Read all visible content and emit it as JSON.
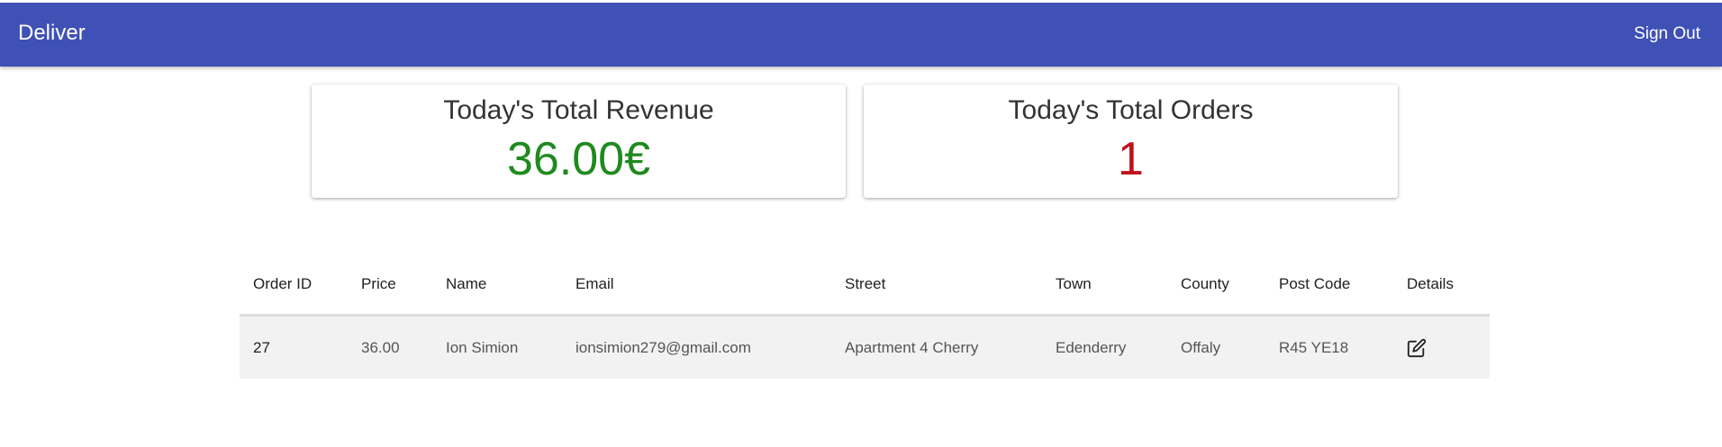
{
  "header": {
    "brand": "Deliver",
    "sign_out_label": "Sign Out",
    "bg_color": "#3f51b5"
  },
  "stats": [
    {
      "title": "Today's Total Revenue",
      "value": "36.00€",
      "color": "#1e8a1e"
    },
    {
      "title": "Today's Total Orders",
      "value": "1",
      "color": "#c0111a"
    }
  ],
  "orders_table": {
    "columns": [
      "Order ID",
      "Price",
      "Name",
      "Email",
      "Street",
      "Town",
      "County",
      "Post Code",
      "Details"
    ],
    "rows": [
      {
        "order_id": "27",
        "price": "36.00",
        "name": "Ion Simion",
        "email": "ionsimion279@gmail.com",
        "street": "Apartment 4 Cherry",
        "town": "Edenderry",
        "county": "Offaly",
        "post_code": "R45 YE18",
        "details_icon": "edit-icon"
      }
    ]
  }
}
